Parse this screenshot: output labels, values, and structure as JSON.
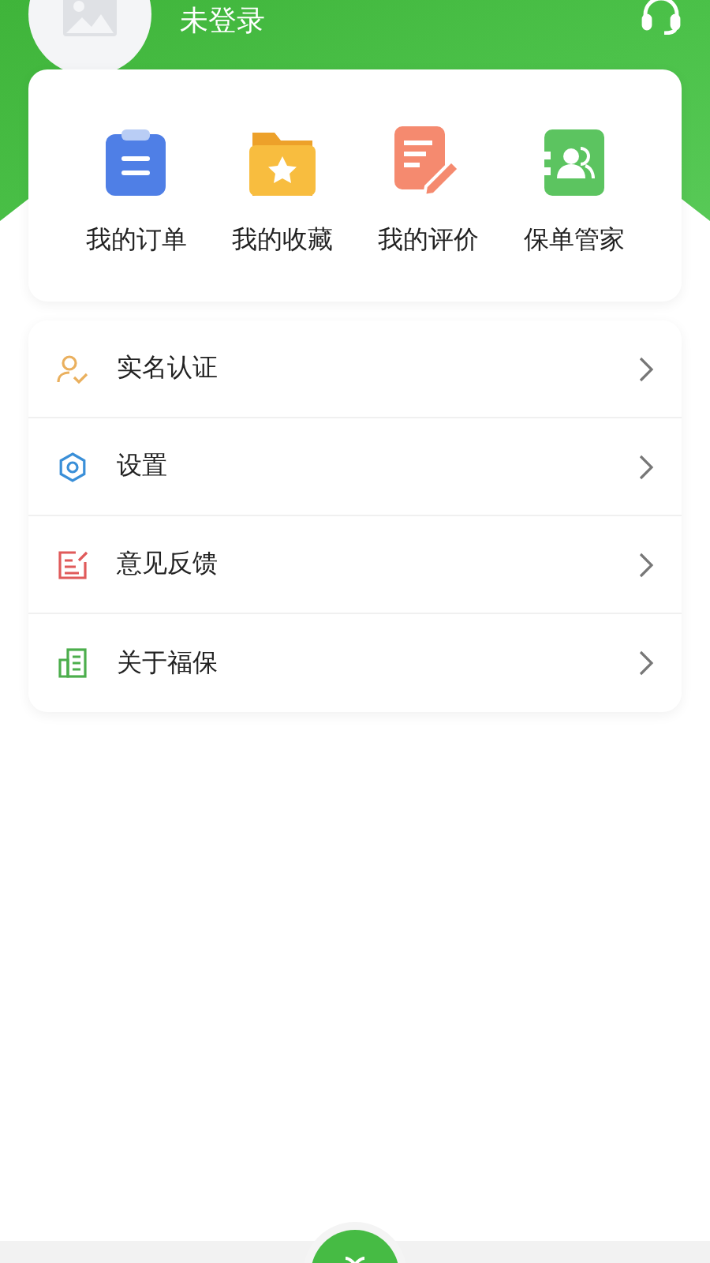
{
  "user": {
    "name": "未登录"
  },
  "quick_actions": [
    {
      "kind": "orders",
      "label": "我的订单"
    },
    {
      "kind": "favorites",
      "label": "我的收藏"
    },
    {
      "kind": "reviews",
      "label": "我的评价"
    },
    {
      "kind": "policies",
      "label": "保单管家"
    }
  ],
  "menu": [
    {
      "kind": "verify",
      "label": "实名认证"
    },
    {
      "kind": "settings",
      "label": "设置"
    },
    {
      "kind": "feedback",
      "label": "意见反馈"
    },
    {
      "kind": "about",
      "label": "关于福保"
    }
  ]
}
